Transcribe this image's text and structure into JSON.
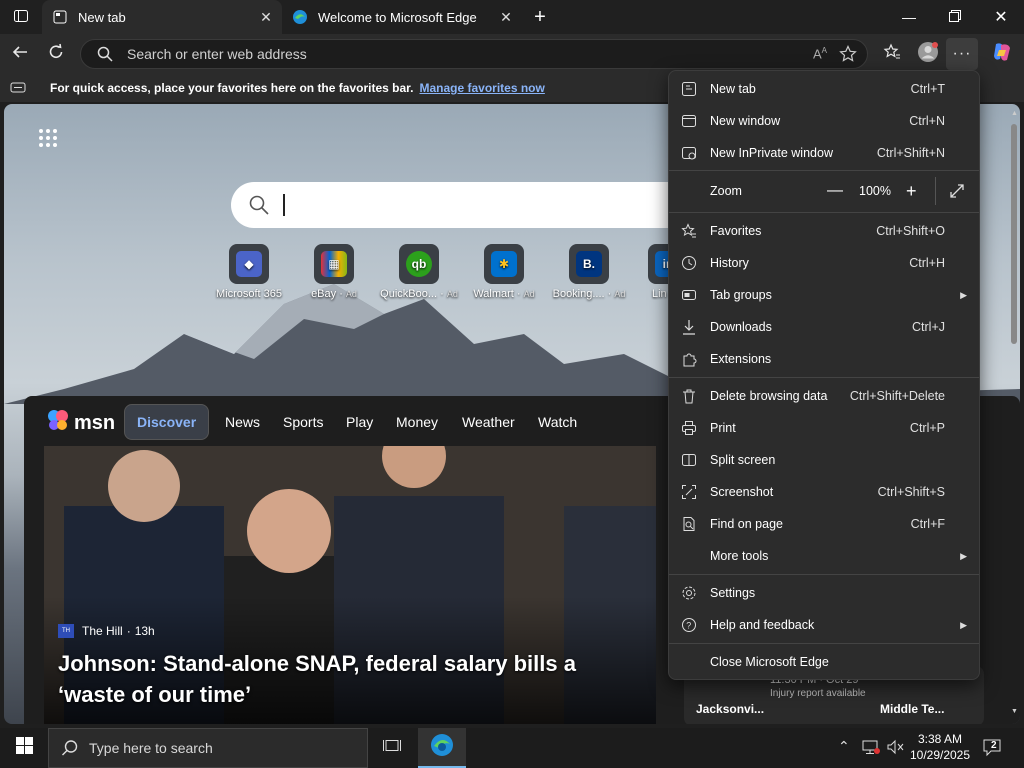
{
  "tabs": [
    {
      "label": "New tab"
    },
    {
      "label": "Welcome to Microsoft Edge"
    }
  ],
  "toolbar": {
    "address_placeholder": "Search or enter web address"
  },
  "favbar": {
    "message": "For quick access, place your favorites here on the favorites bar.",
    "link": "Manage favorites now"
  },
  "ntp": {
    "quicklinks": [
      {
        "label": "Microsoft 365",
        "ad": "",
        "color": "#4b64c8",
        "glyph": "◆"
      },
      {
        "label": "eBay",
        "ad": "Ad",
        "color": "#2b2b2b",
        "glyph": "▦"
      },
      {
        "label": "QuickBoo...",
        "ad": "Ad",
        "color": "#2ca01c",
        "glyph": "qb"
      },
      {
        "label": "Walmart",
        "ad": "Ad",
        "color": "#0071ce",
        "glyph": "✱"
      },
      {
        "label": "Booking....",
        "ad": "Ad",
        "color": "#003580",
        "glyph": "B."
      },
      {
        "label": "Lin",
        "ad": "",
        "color": "#0a66c2",
        "glyph": "in"
      }
    ]
  },
  "msn": {
    "logo": "msn",
    "nav": [
      "Discover",
      "News",
      "Sports",
      "Play",
      "Money",
      "Weather",
      "Watch"
    ],
    "hero": {
      "source": "The Hill",
      "age": "13h",
      "headline": "Johnson: Stand-alone SNAP, federal salary bills a ‘waste of our time’"
    },
    "score": {
      "team1": "Jacksonvi...",
      "team2": "Middle Te...",
      "time": "11:30 PM · Oct 29",
      "note": "Injury report available"
    }
  },
  "menu": {
    "items": [
      {
        "label": "New tab",
        "shortcut": "Ctrl+T",
        "icon": "new-tab-icon"
      },
      {
        "label": "New window",
        "shortcut": "Ctrl+N",
        "icon": "new-window-icon"
      },
      {
        "label": "New InPrivate window",
        "shortcut": "Ctrl+Shift+N",
        "icon": "inprivate-icon"
      },
      {
        "label": "Favorites",
        "shortcut": "Ctrl+Shift+O",
        "icon": "favorites-icon"
      },
      {
        "label": "History",
        "shortcut": "Ctrl+H",
        "icon": "history-icon"
      },
      {
        "label": "Tab groups",
        "shortcut": "",
        "icon": "tab-groups-icon"
      },
      {
        "label": "Downloads",
        "shortcut": "Ctrl+J",
        "icon": "downloads-icon"
      },
      {
        "label": "Extensions",
        "shortcut": "",
        "icon": "extensions-icon"
      },
      {
        "label": "Delete browsing data",
        "shortcut": "Ctrl+Shift+Delete",
        "icon": "delete-data-icon"
      },
      {
        "label": "Print",
        "shortcut": "Ctrl+P",
        "icon": "print-icon"
      },
      {
        "label": "Split screen",
        "shortcut": "",
        "icon": "split-screen-icon"
      },
      {
        "label": "Screenshot",
        "shortcut": "Ctrl+Shift+S",
        "icon": "screenshot-icon"
      },
      {
        "label": "Find on page",
        "shortcut": "Ctrl+F",
        "icon": "find-icon"
      },
      {
        "label": "More tools",
        "shortcut": "",
        "icon": ""
      },
      {
        "label": "Settings",
        "shortcut": "",
        "icon": "settings-icon"
      },
      {
        "label": "Help and feedback",
        "shortcut": "",
        "icon": "help-icon"
      },
      {
        "label": "Close Microsoft Edge",
        "shortcut": "",
        "icon": ""
      }
    ],
    "zoom": {
      "label": "Zoom",
      "value": "100%"
    }
  },
  "taskbar": {
    "search_placeholder": "Type here to search",
    "time": "3:38 AM",
    "date": "10/29/2025",
    "notifications": "2"
  }
}
